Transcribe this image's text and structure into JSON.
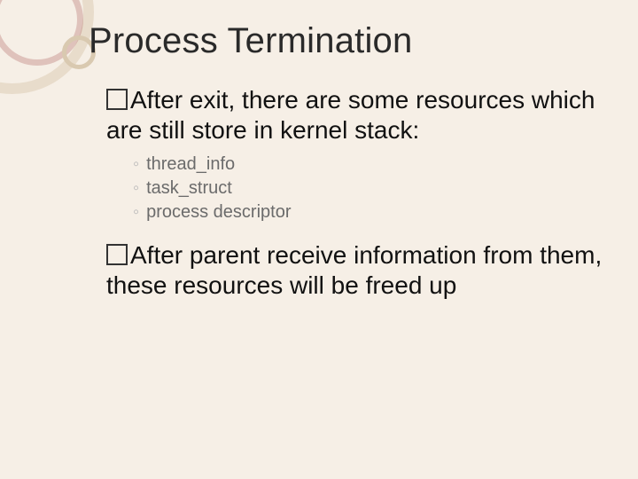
{
  "title": "Process Termination",
  "p1_lead": "After",
  "p1_rest": " exit, there are some resources which are still store in kernel stack:",
  "sub": {
    "a": "thread_info",
    "b": "task_struct",
    "c": "process descriptor"
  },
  "p2_lead": "After",
  "p2_rest": " parent receive information from them, these resources will be freed up"
}
